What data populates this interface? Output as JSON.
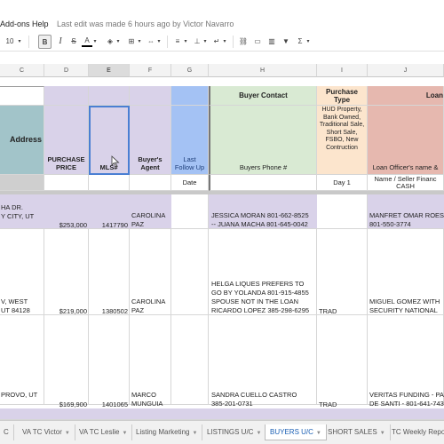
{
  "menu": {
    "addons": "Add-ons",
    "help": "Help",
    "last_edit": "Last edit was made 6 hours ago by Victor Navarro"
  },
  "toolbar": {
    "font_size": "10",
    "bold": "B",
    "italic": "I",
    "strike": "S",
    "text_color": "A"
  },
  "columns": [
    "C",
    "D",
    "E",
    "F",
    "G",
    "H",
    "I",
    "J"
  ],
  "headers": {
    "buyer_contact": "Buyer Contact",
    "purchase_type": "Purchase Type",
    "loan": "Loan",
    "address": "Address",
    "purchase_price": "PURCHASE PRICE",
    "mls": "MLS#",
    "buyers_agent": "Buyer's Agent",
    "last_follow_up": "Last Follow Up",
    "buyers_phone": "Buyers Phone #",
    "purchase_type_options": "HUD Property, Bank Owned, Traditional Sale, Short Sale, FSBO, New Contruction",
    "loan_officer": "Loan Officer's name &",
    "date": "Date",
    "day1": "Day 1",
    "name_seller": "Name / Seller Financ CASH"
  },
  "rows": [
    {
      "address": "HA DR.\nY CITY, UT",
      "price": "$253,000",
      "mls": "1417790",
      "agent": "CAROLINA\nPAZ",
      "contact": "JESSICA MORAN 801-662-8525\n-- JUANA MACHA 801-645-0042",
      "type": "",
      "loan": "MANFRET OMAR ROES\n801-550-3774"
    },
    {
      "address": "V, WEST\nUT 84128",
      "price": "$219,000",
      "mls": "1380502",
      "agent": "CAROLINA\nPAZ",
      "contact": "HELGA LIQUES PREFERS TO\nGO BY YOLANDA 801-915-4855\nSPOUSE NOT IN THE LOAN\nRICARDO LOPEZ 385-298-6295",
      "type": "TRAD",
      "loan": "MIGUEL GOMEZ WITH\nSECURITY NATIONAL"
    },
    {
      "address": "PROVO, UT",
      "price": "$169,900",
      "mls": "1401065",
      "agent": "MARCO\nMUNGUIA",
      "contact": "SANDRA CUELLO CASTRO\n385-201-0731",
      "type": "TRAD",
      "loan": "VERITAS FUNDING - PA\nDE SANTI - 801-641-743"
    }
  ],
  "tabs": [
    "VA TC Victor",
    "VA TC Leslie",
    "Listing Marketing",
    "LISTINGS U/C",
    "BUYERS U/C",
    "SHORT SALES",
    "TC Weekly Repo"
  ],
  "colors": {
    "purple": "#d9d2e9",
    "green": "#d9ead3",
    "blue": "#a4c2f4",
    "peach": "#fce5cd",
    "salmon": "#e6b8af",
    "teal": "#a2c4c9",
    "selection": "#4a7fd3",
    "active_tab_text": "#1a5fb4"
  }
}
